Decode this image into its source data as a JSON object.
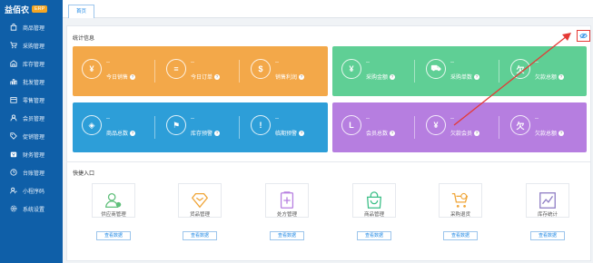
{
  "brand": {
    "name": "益佰农",
    "badge": "ERP"
  },
  "sidebar": {
    "items": [
      {
        "label": "商品管理",
        "icon": "bag-icon"
      },
      {
        "label": "采购管理",
        "icon": "cart-icon"
      },
      {
        "label": "库存管理",
        "icon": "warehouse-icon"
      },
      {
        "label": "批发管理",
        "icon": "wholesale-icon"
      },
      {
        "label": "零售管理",
        "icon": "retail-icon"
      },
      {
        "label": "会员管理",
        "icon": "member-icon"
      },
      {
        "label": "促销管理",
        "icon": "tag-icon"
      },
      {
        "label": "财务管理",
        "icon": "finance-icon"
      },
      {
        "label": "台账管理",
        "icon": "ledger-icon"
      },
      {
        "label": "小程序码",
        "icon": "qrcode-icon"
      },
      {
        "label": "系统设置",
        "icon": "gear-icon"
      }
    ]
  },
  "topbar": {
    "tab_home": "首页"
  },
  "stats": {
    "title": "统计信息",
    "cards": [
      {
        "items": [
          {
            "value": "--",
            "label": "今日销售",
            "glyph": "¥"
          },
          {
            "value": "--",
            "label": "今日订单",
            "glyph": "≡"
          },
          {
            "value": "--",
            "label": "销售利润",
            "glyph": "$"
          }
        ]
      },
      {
        "items": [
          {
            "value": "--",
            "label": "采购金额",
            "glyph": "¥"
          },
          {
            "value": "--",
            "label": "采购单数",
            "glyph": "⛟"
          },
          {
            "value": "--",
            "label": "欠款总额",
            "glyph": "欠"
          }
        ]
      },
      {
        "items": [
          {
            "value": "--",
            "label": "商品总数",
            "glyph": "◈"
          },
          {
            "value": "--",
            "label": "库存预警",
            "glyph": "⚑"
          },
          {
            "value": "--",
            "label": "临期预警",
            "glyph": "!"
          }
        ]
      },
      {
        "items": [
          {
            "value": "--",
            "label": "会员总数",
            "glyph": "L"
          },
          {
            "value": "--",
            "label": "欠款会员",
            "glyph": "¥"
          },
          {
            "value": "--",
            "label": "欠款总额",
            "glyph": "欠"
          }
        ]
      }
    ]
  },
  "quick": {
    "title": "快捷入口",
    "items": [
      {
        "label": "供应商管理",
        "button": "查看数据",
        "icon": "supplier-icon"
      },
      {
        "label": "货品管理",
        "button": "查看数据",
        "icon": "goods-icon"
      },
      {
        "label": "处方管理",
        "button": "查看数据",
        "icon": "prescription-icon"
      },
      {
        "label": "商品管理",
        "button": "查看数据",
        "icon": "product-bag-icon"
      },
      {
        "label": "采购退货",
        "button": "查看数据",
        "icon": "purchase-return-icon"
      },
      {
        "label": "库存统计",
        "button": "查看数据",
        "icon": "inventory-chart-icon"
      }
    ]
  },
  "colors": {
    "sidebar": "#0f5fa8",
    "orange": "#f3a849",
    "green": "#5fcf95",
    "blue": "#2d9ed8",
    "purple": "#b67ee0",
    "annotation": "#e53935"
  }
}
